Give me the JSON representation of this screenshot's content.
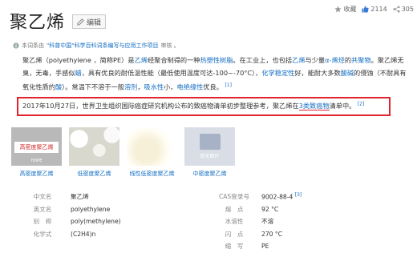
{
  "header": {
    "title": "聚乙烯",
    "edit_label": "编辑",
    "favorite_label": "收藏",
    "like_count": "2114",
    "share_count": "305"
  },
  "meta": {
    "prefix": "本词条由",
    "source": "\"科普中国\"科学百科词条编写与应用工作项目",
    "suffix": "审核 。"
  },
  "intro": {
    "p1": "聚乙烯（polyethylene ，简称PE）是",
    "l1": "乙烯",
    "p2": "经聚合制得的一种",
    "l2": "热塑性树脂",
    "p3": "。在工业上，也包括",
    "l3": "乙烯",
    "p4": "与少量",
    "l4": "α-烯烃",
    "p5": "的",
    "l5": "共聚物",
    "p6": "。聚乙烯无臭，无毒，手感似",
    "l6": "蜡",
    "p7": "，具有优良的耐低温性能（最低使用温度可达-100~-70°C），",
    "l7": "化学稳定性",
    "p8": "好，能耐大多数",
    "l8": "酸碱",
    "p9": "的侵蚀（不耐具有氧化性质的",
    "l9": "酸",
    "p10": "）。常温下不溶于一般",
    "l10": "溶剂",
    "p11": "，",
    "l11": "吸水性",
    "p12": "小，",
    "l12": "电绝缘性",
    "p13": "优良。",
    "ref": "[1]"
  },
  "highlight": {
    "t1": "2017年10月27日，世界卫生组织国际癌症研究机构公布的致癌物清单初步整理参考，聚乙烯在",
    "t2": "3类致癌物",
    "t3": "清单中。",
    "ref": "[2]"
  },
  "gallery": [
    {
      "caption": "高密度聚乙烯",
      "label": "高密度聚乙烯",
      "sublabel": "HDPE"
    },
    {
      "caption": "低密度聚乙烯"
    },
    {
      "caption": "线性低密度聚乙烯"
    },
    {
      "caption": "中密度聚乙烯",
      "placeholder": "暂无图片"
    }
  ],
  "info": [
    {
      "k1": "中文名",
      "v1": "聚乙烯",
      "k2": "CAS登录号",
      "v2": "9002-88-4",
      "ref": "[3]"
    },
    {
      "k1": "英文名",
      "v1": "polyethylene",
      "k2": "熔　点",
      "v2": "92 °C"
    },
    {
      "k1": "别　称",
      "v1": "poly(methylene)",
      "k2": "水溶性",
      "v2": "不溶"
    },
    {
      "k1": "化学式",
      "v1": "(C2H4)n",
      "k2": "闪　点",
      "v2": "270 °C"
    },
    {
      "k1": "",
      "v1": "",
      "k2": "缩　写",
      "v2": "PE"
    }
  ],
  "colors": {
    "link": "#136ec2",
    "highlight_border": "#e0232d"
  },
  "icons": [
    "edit-icon",
    "star-icon",
    "thumb-up-icon",
    "share-icon",
    "info-icon"
  ]
}
